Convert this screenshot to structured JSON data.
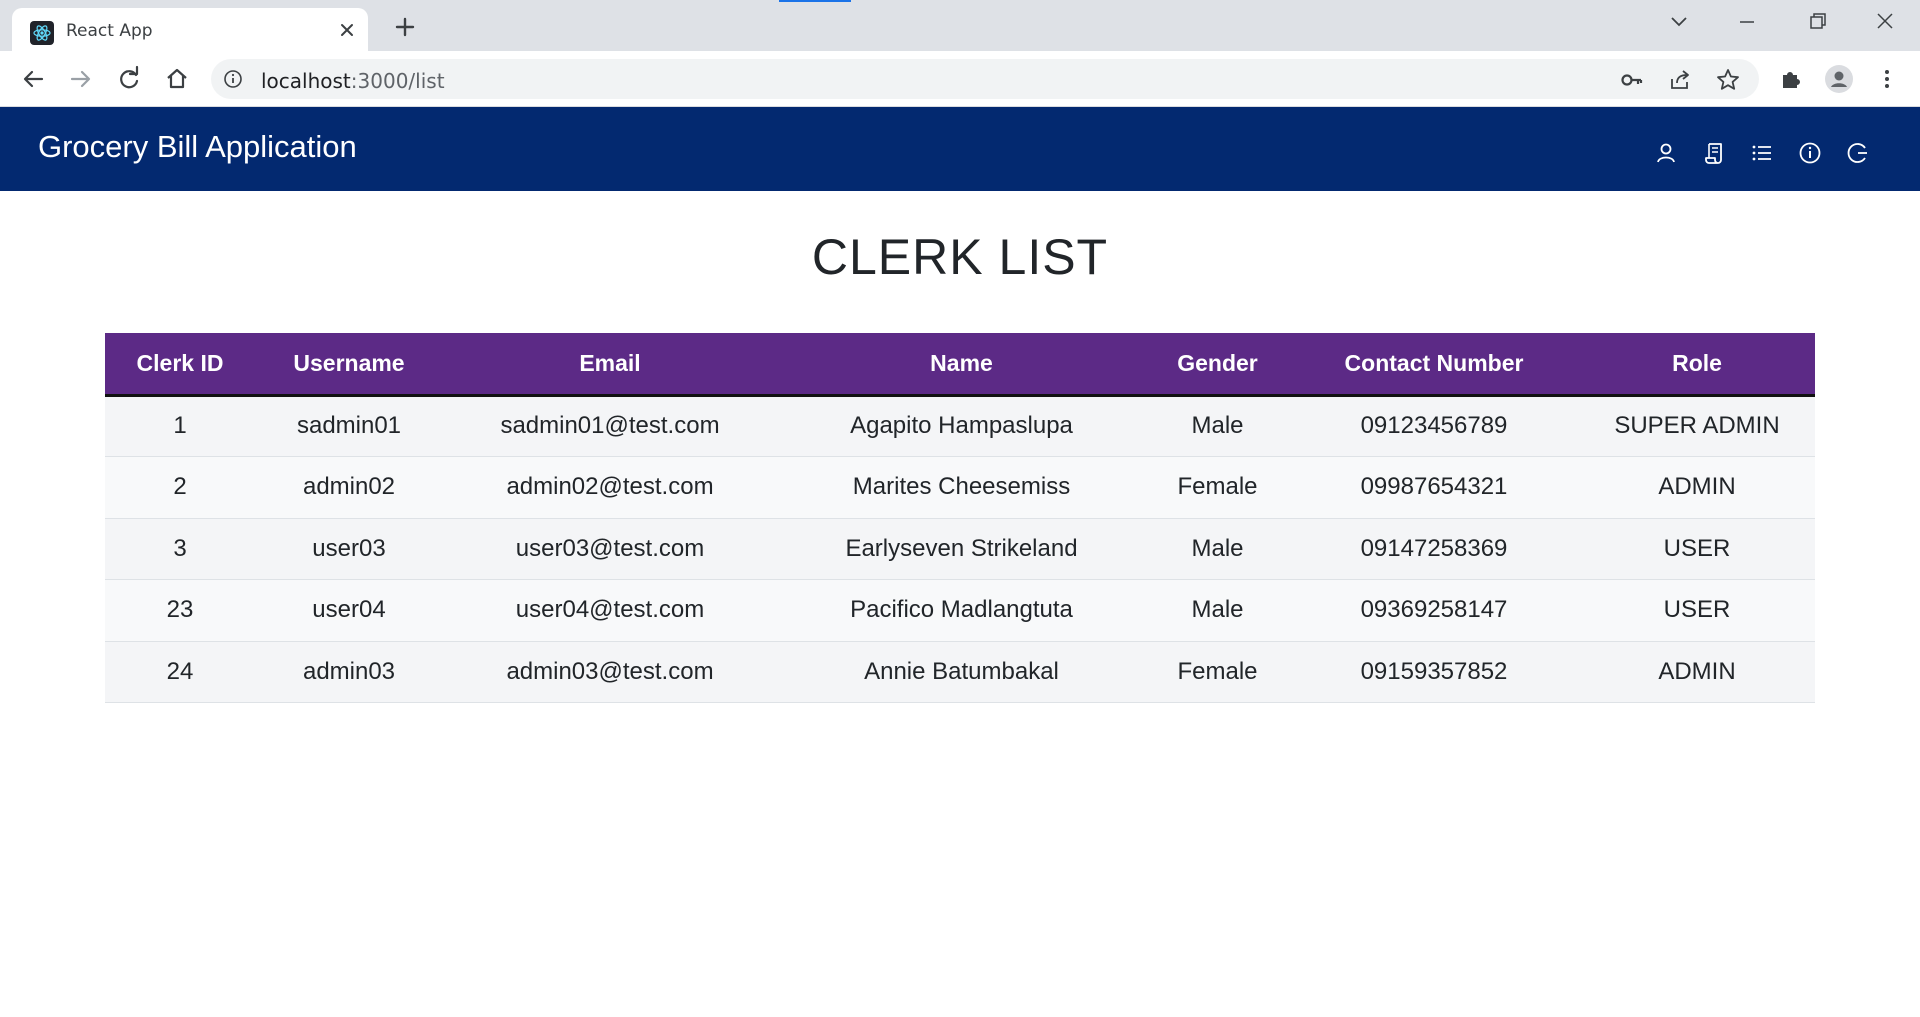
{
  "browser": {
    "tab": {
      "title": "React App",
      "favicon": "react-logo-icon"
    },
    "url": {
      "host": "localhost",
      "rest": ":3000/list"
    },
    "icons": [
      "back-icon",
      "forward-icon",
      "reload-icon",
      "home-icon",
      "site-info-icon",
      "key-icon",
      "share-icon",
      "bookmark-star-icon",
      "extensions-icon",
      "profile-icon",
      "menu-icon"
    ]
  },
  "navbar": {
    "brand": "Grocery Bill Application",
    "icons": [
      "user-icon",
      "bill-icon",
      "list-icon",
      "info-icon",
      "logout-icon"
    ],
    "background": "#032970"
  },
  "page": {
    "title": "CLERK LIST"
  },
  "table": {
    "header_color": "#5c2a86",
    "columns": [
      "Clerk ID",
      "Username",
      "Email",
      "Name",
      "Gender",
      "Contact Number",
      "Role"
    ],
    "rows": [
      [
        "1",
        "sadmin01",
        "sadmin01@test.com",
        "Agapito Hampaslupa",
        "Male",
        "09123456789",
        "SUPER ADMIN"
      ],
      [
        "2",
        "admin02",
        "admin02@test.com",
        "Marites Cheesemiss",
        "Female",
        "09987654321",
        "ADMIN"
      ],
      [
        "3",
        "user03",
        "user03@test.com",
        "Earlyseven Strikeland",
        "Male",
        "09147258369",
        "USER"
      ],
      [
        "23",
        "user04",
        "user04@test.com",
        "Pacifico Madlangtuta",
        "Male",
        "09369258147",
        "USER"
      ],
      [
        "24",
        "admin03",
        "admin03@test.com",
        "Annie Batumbakal",
        "Female",
        "09159357852",
        "ADMIN"
      ]
    ]
  }
}
